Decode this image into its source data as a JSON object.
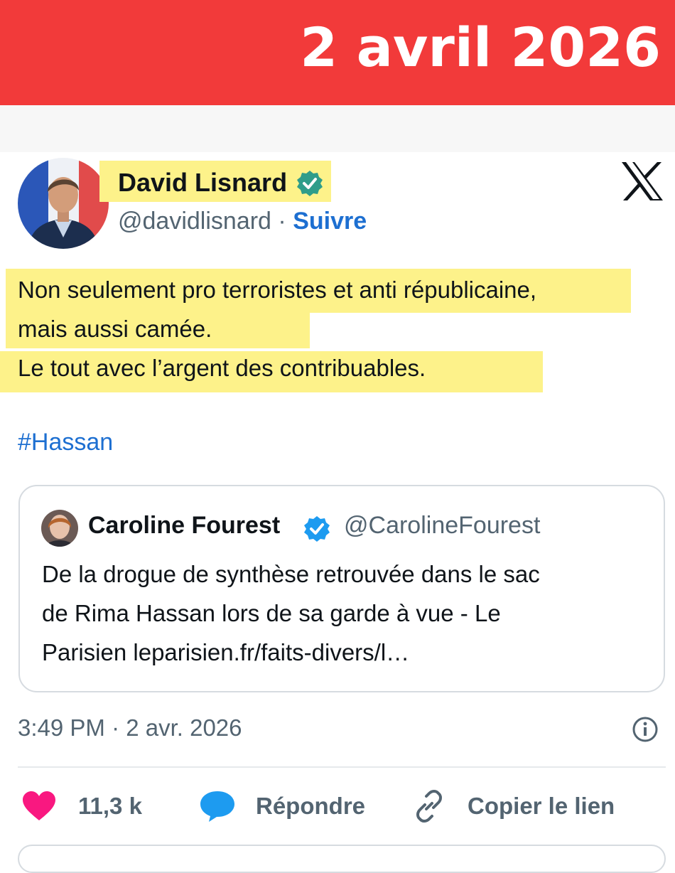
{
  "banner": {
    "date": "2 avril 2026",
    "color": "#f23a3a"
  },
  "author": {
    "name": "David Lisnard",
    "handle": "@davidlisnard",
    "separator": "·",
    "follow_label": "Suivre",
    "verified": true
  },
  "platform_icon": "x-logo-icon",
  "tweet": {
    "lines": [
      "Non seulement pro terroristes et anti républicaine,",
      "mais aussi camée.",
      "Le tout avec l’argent des contribuables."
    ],
    "hashtag": "#Hassan"
  },
  "quoted": {
    "name": "Caroline Fourest",
    "handle": "@CarolineFourest",
    "verified": true,
    "lines": [
      "De la drogue de synthèse retrouvée dans le sac",
      "de Rima Hassan lors de sa garde à vue - Le",
      "Parisien leparisien.fr/faits-divers/l…"
    ]
  },
  "timestamp": "3:49 PM · 2 avr. 2026",
  "actions": {
    "like_count": "11,3 k",
    "reply_label": "Répondre",
    "copy_link_label": "Copier le lien"
  },
  "colors": {
    "highlight": "#fdf28a",
    "link": "#1d6fd1",
    "heart": "#f91880",
    "reply": "#1d9bf0",
    "verified": "#1d9bf0"
  }
}
